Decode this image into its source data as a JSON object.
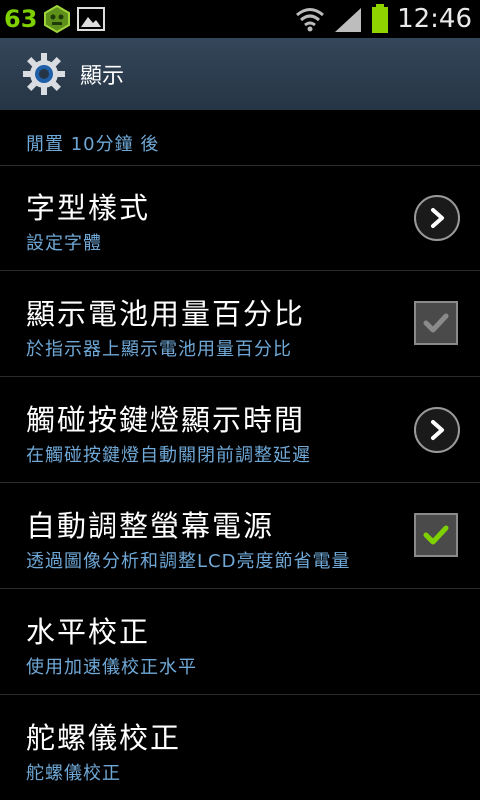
{
  "status_bar": {
    "badge": "63",
    "time": "12:46"
  },
  "header": {
    "title": "顯示"
  },
  "items": [
    {
      "title": "",
      "subtitle": "閒置 10分鐘 後",
      "control": "chevron"
    },
    {
      "title": "字型樣式",
      "subtitle": "設定字體",
      "control": "chevron"
    },
    {
      "title": "顯示電池用量百分比",
      "subtitle": "於指示器上顯示電池用量百分比",
      "control": "checkbox",
      "checked": false
    },
    {
      "title": "觸碰按鍵燈顯示時間",
      "subtitle": "在觸碰按鍵燈自動關閉前調整延遲",
      "control": "chevron"
    },
    {
      "title": "自動調整螢幕電源",
      "subtitle": "透過圖像分析和調整LCD亮度節省電量",
      "control": "checkbox",
      "checked": true
    },
    {
      "title": "水平校正",
      "subtitle": "使用加速儀校正水平",
      "control": "none"
    },
    {
      "title": "舵螺儀校正",
      "subtitle": "舵螺儀校正",
      "control": "none"
    }
  ],
  "colors": {
    "accent_green": "#7fd000",
    "subtitle_blue": "#6fa8d6",
    "header_bg": "#2e3f52"
  }
}
